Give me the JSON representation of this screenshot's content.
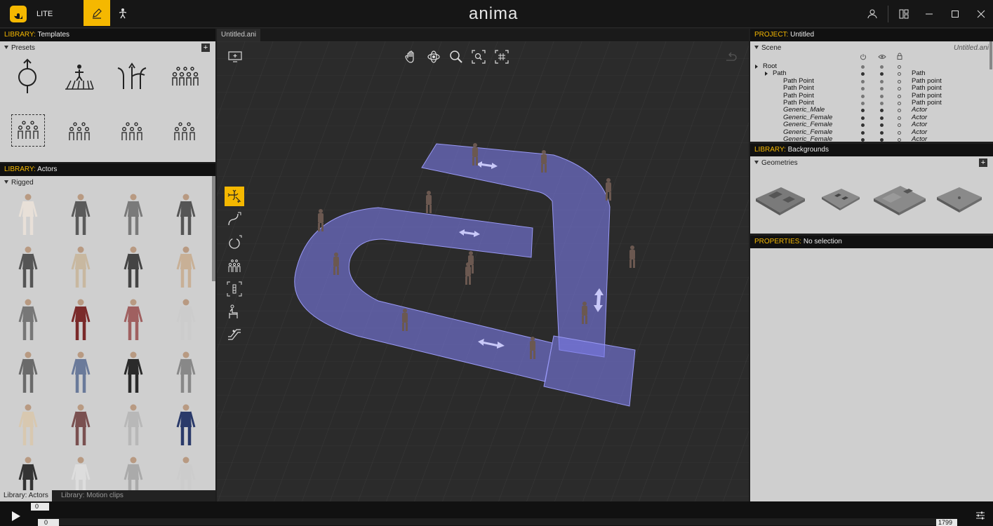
{
  "app": {
    "edition": "LITE",
    "brand": "anima"
  },
  "colors": {
    "accent": "#f5b800",
    "path": "#7b7be8"
  },
  "topbar": {
    "mode_buttons": [
      {
        "icon": "pencil-icon",
        "active": true
      },
      {
        "icon": "actor-icon",
        "active": false
      }
    ],
    "window_buttons": [
      "user-icon",
      "layout-icon",
      "minimize-icon",
      "maximize-icon",
      "close-icon"
    ]
  },
  "library_templates": {
    "prefix": "LIBRARY:",
    "title": "Templates",
    "section": "Presets"
  },
  "library_actors": {
    "prefix": "LIBRARY:",
    "title": "Actors",
    "section": "Rigged"
  },
  "bottom_tabs": [
    "Library: Actors",
    "Library: Motion clips"
  ],
  "viewport": {
    "tab": "Untitled.ani",
    "tools": [
      "hand-icon",
      "orbit-icon",
      "zoom-icon",
      "zoom-region-icon",
      "frame-all-icon"
    ],
    "left_tools": [
      "select-move-icon",
      "path-tool-icon",
      "loop-tool-icon",
      "crowd-tool-icon",
      "area-tool-icon",
      "seat-tool-icon",
      "stairs-tool-icon"
    ]
  },
  "project": {
    "prefix": "PROJECT:",
    "title": "Untitled",
    "section": "Scene",
    "file": "Untitled.ani",
    "rows": [
      {
        "name": "Root",
        "type": "",
        "italic": false
      },
      {
        "name": "Path",
        "type": "Path",
        "italic": false
      },
      {
        "name": "Path Point",
        "type": "Path point",
        "italic": false
      },
      {
        "name": "Path Point",
        "type": "Path point",
        "italic": false
      },
      {
        "name": "Path Point",
        "type": "Path point",
        "italic": false
      },
      {
        "name": "Path Point",
        "type": "Path point",
        "italic": false
      },
      {
        "name": "Generic_Male",
        "type": "Actor",
        "italic": true
      },
      {
        "name": "Generic_Female",
        "type": "Actor",
        "italic": true
      },
      {
        "name": "Generic_Female",
        "type": "Actor",
        "italic": true
      },
      {
        "name": "Generic_Female",
        "type": "Actor",
        "italic": true
      },
      {
        "name": "Generic_Female",
        "type": "Actor",
        "italic": true
      }
    ]
  },
  "library_backgrounds": {
    "prefix": "LIBRARY:",
    "title": "Backgrounds",
    "section": "Geometries"
  },
  "properties": {
    "prefix": "PROPERTIES:",
    "title": "No selection"
  },
  "timeline": {
    "current_frame": "0",
    "start": "0",
    "end": "1799"
  }
}
